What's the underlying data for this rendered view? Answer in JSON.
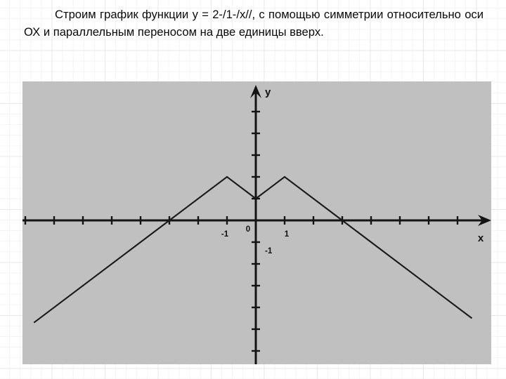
{
  "slide": {
    "caption": "Строим график функции y = 2-/1-/x//, с помощью симметрии относительно оси ОХ и параллельным переносом на две единицы вверх.",
    "background_color": "#ffffff",
    "grid_color": "#e9e9e9",
    "plot_background_color": "#c0c0c0",
    "line_color": "#1a1a1a"
  },
  "chart_data": {
    "type": "line",
    "title": "",
    "xlabel": "x",
    "ylabel": "y",
    "function": "y = 2-|1-|x||",
    "grid": false,
    "legend": false,
    "xlim": [
      -8.1,
      8.15
    ],
    "ylim": [
      -6.4,
      6.35
    ],
    "x_tick_labels": [
      "-1",
      "1"
    ],
    "x_tick_label_values": [
      -1,
      1
    ],
    "y_tick_labels": [
      "-1"
    ],
    "y_tick_label_values": [
      -1
    ],
    "origin_label": "0",
    "x_ticks": [
      -8,
      -7,
      -6,
      -5,
      -4,
      -3,
      -2,
      -1,
      1,
      2,
      3,
      4,
      5,
      6,
      7,
      8
    ],
    "y_ticks": [
      -6,
      -5,
      -4,
      -3,
      -2,
      -1,
      1,
      2,
      3,
      4,
      5,
      6
    ],
    "series": [
      {
        "name": "y = 2-|1-|x||",
        "x": [
          -7.7,
          -3,
          -1,
          0,
          1,
          3,
          7.5
        ],
        "values": [
          -4.7,
          0,
          2,
          1,
          2,
          0,
          -4.5
        ]
      }
    ],
    "key_points": {
      "peaks": [
        [
          -1,
          2
        ],
        [
          1,
          2
        ]
      ],
      "valley": [
        0,
        1
      ],
      "zeros": [
        -3,
        3
      ]
    }
  },
  "icons": {
    "y_axis_arrow": "arrow-up-icon",
    "x_axis_arrow": "arrow-right-icon"
  }
}
